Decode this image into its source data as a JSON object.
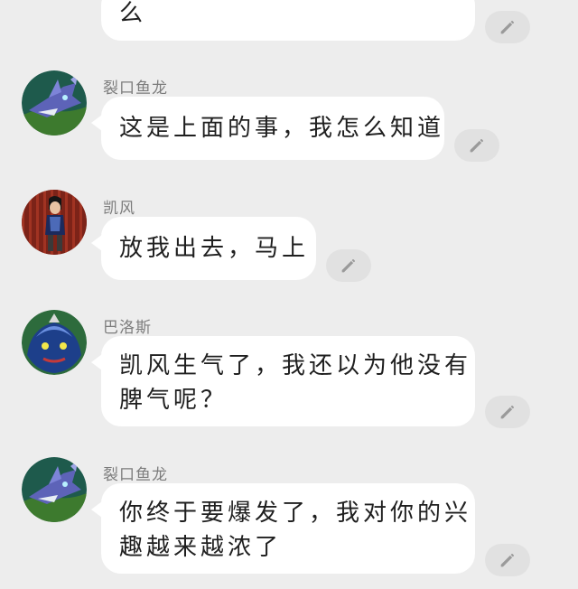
{
  "messages": [
    {
      "sender": "",
      "lines": [
        "么"
      ]
    },
    {
      "sender": "裂口鱼龙",
      "lines": [
        "这是上面的事，我怎么知道"
      ]
    },
    {
      "sender": "凯风",
      "lines": [
        "放我出去，马上"
      ]
    },
    {
      "sender": "巴洛斯",
      "lines": [
        "凯风生气了，我还以为他没有",
        "脾气呢？"
      ]
    },
    {
      "sender": "裂口鱼龙",
      "lines": [
        "你终于要爆发了，我对你的兴",
        "趣越来越浓了"
      ]
    }
  ],
  "icons": {
    "edit": "pencil-icon"
  },
  "colors": {
    "background": "#ededed",
    "bubble": "#ffffff",
    "edit_button": "#e1e1e1",
    "pencil": "#9a9a9a"
  }
}
